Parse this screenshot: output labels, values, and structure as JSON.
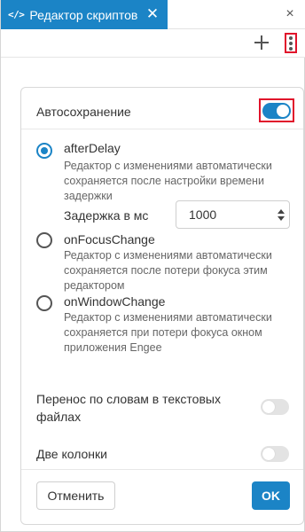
{
  "tab": {
    "icon": "code-icon",
    "icon_glyph": "</>",
    "label": "Редактор скриптов",
    "close_glyph": "✕"
  },
  "window": {
    "close_glyph": "×"
  },
  "toolbar": {
    "add_icon": "plus-icon",
    "menu_icon": "kebab-menu-icon"
  },
  "settings": {
    "autosave": {
      "label": "Автосохранение",
      "enabled": true
    },
    "mode_options": [
      {
        "value": "afterDelay",
        "description": "Редактор с изменениями автоматически сохраняется после настройки времени задержки",
        "selected": true
      },
      {
        "value": "onFocusChange",
        "description": "Редактор с изменениями автоматически сохраняется после потери фокуса этим редактором",
        "selected": false
      },
      {
        "value": "onWindowChange",
        "description": "Редактор с изменениями автоматически сохраняется при потери фокуса окном приложения Engee",
        "selected": false
      }
    ],
    "delay": {
      "label": "Задержка в мс",
      "value": "1000"
    },
    "word_wrap": {
      "label": "Перенос по словам в текстовых файлах",
      "enabled": false
    },
    "two_columns": {
      "label": "Две колонки",
      "enabled": false
    }
  },
  "buttons": {
    "cancel": "Отменить",
    "ok": "OK"
  },
  "colors": {
    "accent": "#1b84c6",
    "highlight_border": "#e0132b",
    "toggle_off": "#e3e3e3"
  }
}
